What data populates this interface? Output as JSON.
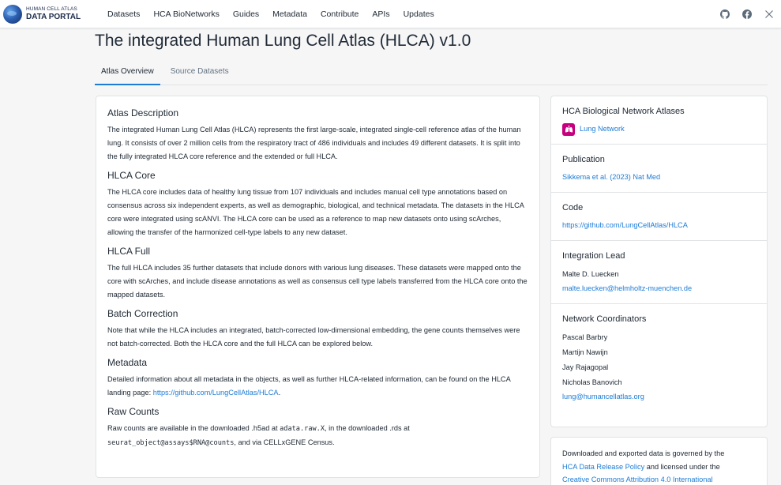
{
  "header": {
    "logo_line1": "HUMAN CELL ATLAS",
    "logo_line2": "DATA PORTAL",
    "nav": [
      "Datasets",
      "HCA BioNetworks",
      "Guides",
      "Metadata",
      "Contribute",
      "APIs",
      "Updates"
    ],
    "social_icons": [
      "github-icon",
      "facebook-icon",
      "x-icon"
    ]
  },
  "page_title": "The integrated Human Lung Cell Atlas (HLCA) v1.0",
  "tabs": [
    "Atlas Overview",
    "Source Datasets"
  ],
  "active_tab": "Atlas Overview",
  "main": {
    "atlas_description": {
      "title": "Atlas Description",
      "body": "The integrated Human Lung Cell Atlas (HLCA) represents the first large-scale, integrated single-cell reference atlas of the human lung. It consists of over 2 million cells from the respiratory tract of 486 individuals and includes 49 different datasets. It is split into the fully integrated HLCA core reference and the extended or full HLCA."
    },
    "hlca_core": {
      "title": "HLCA Core",
      "body": "The HLCA core includes data of healthy lung tissue from 107 individuals and includes manual cell type annotations based on consensus across six independent experts, as well as demographic, biological, and technical metadata. The datasets in the HLCA core were integrated using scANVI. The HLCA core can be used as a reference to map new datasets onto using scArches, allowing the transfer of the harmonized cell-type labels to any new dataset."
    },
    "hlca_full": {
      "title": "HLCA Full",
      "body": "The full HLCA includes 35 further datasets that include donors with various lung diseases. These datasets were mapped onto the core with scArches, and include disease annotations as well as consensus cell type labels transferred from the HLCA core onto the mapped datasets."
    },
    "batch_correction": {
      "title": "Batch Correction",
      "body": "Note that while the HLCA includes an integrated, batch-corrected low-dimensional embedding, the gene counts themselves were not batch-corrected. Both the HLCA core and the full HLCA can be explored below."
    },
    "metadata": {
      "title": "Metadata",
      "body_prefix": "Detailed information about all metadata in the objects, as well as further HLCA-related information, can be found on the HLCA landing page: ",
      "link": "https://github.com/LungCellAtlas/HLCA",
      "body_suffix": "."
    },
    "raw_counts": {
      "title": "Raw Counts",
      "part1": "Raw counts are available in the downloaded .h5ad at ",
      "code1": "adata.raw.X",
      "part2": ", in the downloaded .rds at",
      "code2": "seurat_object@assays$RNA@counts",
      "part3": ", and via CELLxGENE Census."
    }
  },
  "sidebar": {
    "networks": {
      "title": "HCA Biological Network Atlases",
      "link": "Lung Network"
    },
    "publication": {
      "title": "Publication",
      "link": "Sikkema et al. (2023) Nat Med"
    },
    "code": {
      "title": "Code",
      "link": "https://github.com/LungCellAtlas/HLCA"
    },
    "integration_lead": {
      "title": "Integration Lead",
      "name": "Malte D. Luecken",
      "email": "malte.luecken@helmholtz-muenchen.de"
    },
    "coordinators": {
      "title": "Network Coordinators",
      "names": [
        "Pascal Barbry",
        "Martijn Nawijn",
        "Jay Rajagopal",
        "Nicholas Banovich"
      ],
      "email": "lung@humancellatlas.org"
    }
  },
  "policy": {
    "part1": "Downloaded and exported data is governed by the",
    "link1": "HCA Data Release Policy",
    "part2": " and licensed under the",
    "link2": "Creative Commons Attribution 4.0 International"
  },
  "colors": {
    "link": "#1c7cd6",
    "tab_indicator": "#1c7cd6",
    "network_icon_bg": "#c6007e"
  }
}
